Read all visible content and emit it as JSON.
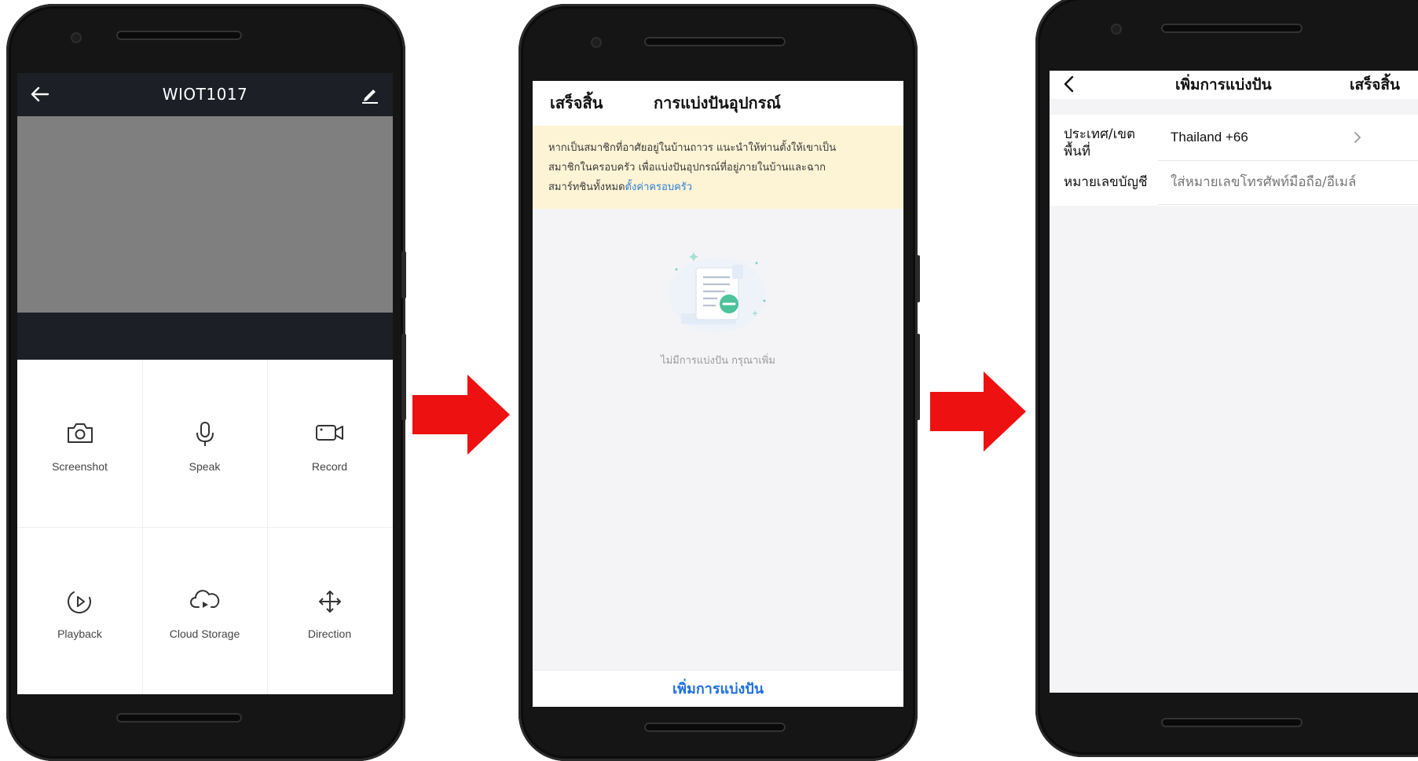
{
  "colors": {
    "arrow": "#ee1111",
    "link_blue": "#2f7fd6",
    "button_blue": "#1f6fe0",
    "notice_bg": "#fdf3d5",
    "header_dark": "#1c1f26",
    "video_gray": "#7f7f7f"
  },
  "screen1": {
    "title": "WIOT1017",
    "icons": {
      "back": "arrow-left-icon",
      "edit": "pencil-icon"
    },
    "actions": [
      {
        "label": "Screenshot",
        "icon": "camera-icon"
      },
      {
        "label": "Speak",
        "icon": "microphone-icon"
      },
      {
        "label": "Record",
        "icon": "video-camera-icon"
      },
      {
        "label": "Playback",
        "icon": "playback-icon"
      },
      {
        "label": "Cloud Storage",
        "icon": "cloud-play-icon"
      },
      {
        "label": "Direction",
        "icon": "move-arrows-icon"
      }
    ]
  },
  "screen2": {
    "done_label": "เสร็จสิ้น",
    "title": "การแบ่งปันอุปกรณ์",
    "notice_line1": "หากเป็นสมาชิกที่อาศัยอยู่ในบ้านถาวร แนะนำให้ท่านตั้งให้เขาเป็น",
    "notice_line2": "สมาชิกในครอบครัว เพื่อแบ่งปันอุปกรณ์ที่อยู่ภายในบ้านและฉาก",
    "notice_line3": "สมาร์ทชินทั้งหมด",
    "notice_link": "ตั้งค่าครอบครัว",
    "empty_text": "ไม่มีการแบ่งปัน กรุณาเพิ่ม",
    "add_button": "เพิ่มการแบ่งปัน"
  },
  "screen3": {
    "title": "เพิ่มการแบ่งปัน",
    "done_label": "เสร็จสิ้น",
    "country_label_line1": "ประเทศ/เขต",
    "country_label_line2": "พื้นที่",
    "country_value": "Thailand +66",
    "account_label": "หมายเลขบัญชี",
    "account_placeholder": "ใส่หมายเลขโทรศัพท์มือถือ/อีเมล์"
  }
}
